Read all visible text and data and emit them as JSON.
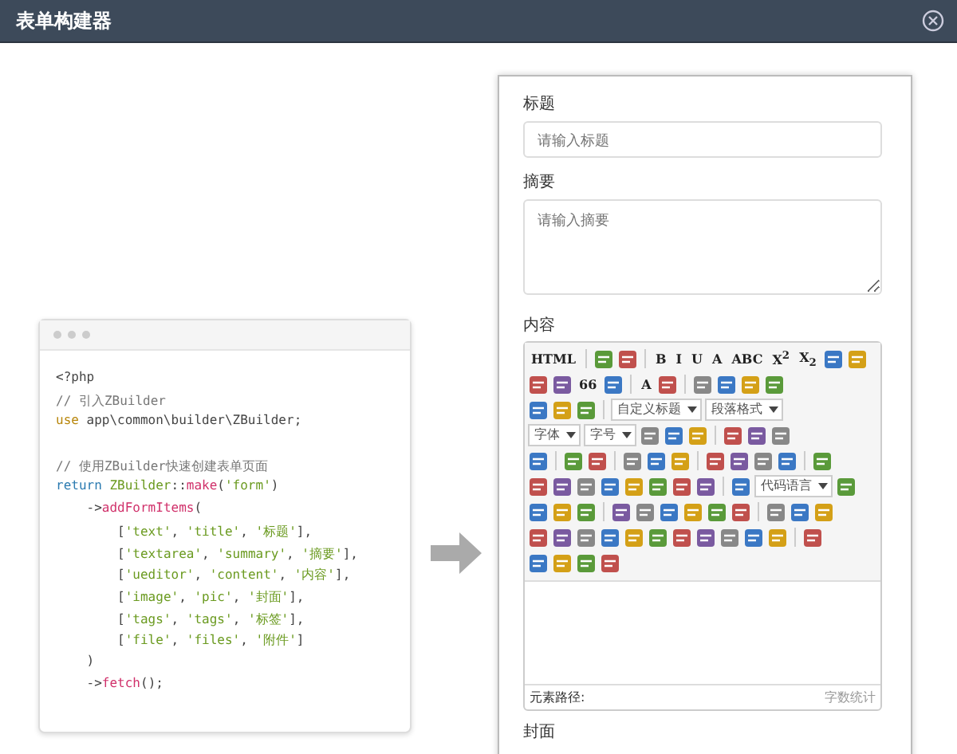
{
  "window": {
    "title": "表单构建器"
  },
  "code": {
    "lines": [
      [
        {
          "kind": "plain",
          "text": "<?php"
        }
      ],
      [
        {
          "kind": "comment",
          "text": "// 引入ZBuilder"
        }
      ],
      [
        {
          "kind": "keyword",
          "text": "use"
        },
        {
          "kind": "plain",
          "text": " app\\common\\builder\\ZBuilder;"
        }
      ],
      [
        {
          "kind": "comment",
          "text": "// 使用ZBuilder快速创建表单页面",
          "gap_before": true
        }
      ],
      [
        {
          "kind": "return",
          "text": "return "
        },
        {
          "kind": "string",
          "text": "ZBuilder"
        },
        {
          "kind": "plain",
          "text": "::"
        },
        {
          "kind": "func",
          "text": "make"
        },
        {
          "kind": "plain",
          "text": "("
        },
        {
          "kind": "string",
          "text": "'form'"
        },
        {
          "kind": "plain",
          "text": ")"
        }
      ],
      [
        {
          "kind": "plain",
          "text": "    ->"
        },
        {
          "kind": "func",
          "text": "addFormItems"
        },
        {
          "kind": "plain",
          "text": "("
        }
      ],
      [
        {
          "kind": "plain",
          "text": "        ["
        },
        {
          "kind": "string",
          "text": "'text'"
        },
        {
          "kind": "plain",
          "text": ", "
        },
        {
          "kind": "string",
          "text": "'title'"
        },
        {
          "kind": "plain",
          "text": ", "
        },
        {
          "kind": "string",
          "text": "'标题'"
        },
        {
          "kind": "plain",
          "text": "],"
        }
      ],
      [
        {
          "kind": "plain",
          "text": "        ["
        },
        {
          "kind": "string",
          "text": "'textarea'"
        },
        {
          "kind": "plain",
          "text": ", "
        },
        {
          "kind": "string",
          "text": "'summary'"
        },
        {
          "kind": "plain",
          "text": ", "
        },
        {
          "kind": "string",
          "text": "'摘要'"
        },
        {
          "kind": "plain",
          "text": "],"
        }
      ],
      [
        {
          "kind": "plain",
          "text": "        ["
        },
        {
          "kind": "string",
          "text": "'ueditor'"
        },
        {
          "kind": "plain",
          "text": ", "
        },
        {
          "kind": "string",
          "text": "'content'"
        },
        {
          "kind": "plain",
          "text": ", "
        },
        {
          "kind": "string",
          "text": "'内容'"
        },
        {
          "kind": "plain",
          "text": "],"
        }
      ],
      [
        {
          "kind": "plain",
          "text": "        ["
        },
        {
          "kind": "string",
          "text": "'image'"
        },
        {
          "kind": "plain",
          "text": ", "
        },
        {
          "kind": "string",
          "text": "'pic'"
        },
        {
          "kind": "plain",
          "text": ", "
        },
        {
          "kind": "string",
          "text": "'封面'"
        },
        {
          "kind": "plain",
          "text": "],"
        }
      ],
      [
        {
          "kind": "plain",
          "text": "        ["
        },
        {
          "kind": "string",
          "text": "'tags'"
        },
        {
          "kind": "plain",
          "text": ", "
        },
        {
          "kind": "string",
          "text": "'tags'"
        },
        {
          "kind": "plain",
          "text": ", "
        },
        {
          "kind": "string",
          "text": "'标签'"
        },
        {
          "kind": "plain",
          "text": "],"
        }
      ],
      [
        {
          "kind": "plain",
          "text": "        ["
        },
        {
          "kind": "string",
          "text": "'file'"
        },
        {
          "kind": "plain",
          "text": ", "
        },
        {
          "kind": "string",
          "text": "'files'"
        },
        {
          "kind": "plain",
          "text": ", "
        },
        {
          "kind": "string",
          "text": "'附件'"
        },
        {
          "kind": "plain",
          "text": "]"
        }
      ],
      [
        {
          "kind": "plain",
          "text": "    )"
        }
      ],
      [
        {
          "kind": "plain",
          "text": "    ->"
        },
        {
          "kind": "func",
          "text": "fetch"
        },
        {
          "kind": "plain",
          "text": "();"
        }
      ]
    ]
  },
  "form": {
    "title_field": {
      "label": "标题",
      "placeholder": "请输入标题"
    },
    "summary_field": {
      "label": "摘要",
      "placeholder": "请输入摘要"
    },
    "content_field": {
      "label": "内容",
      "toolbar": [
        [
          {
            "kind": "text",
            "text": "HTML"
          },
          {
            "kind": "sep"
          },
          {
            "kind": "icon"
          },
          {
            "kind": "icon"
          },
          {
            "kind": "sep"
          },
          {
            "kind": "text",
            "text": "B"
          },
          {
            "kind": "text",
            "text": "I"
          },
          {
            "kind": "text",
            "text": "U"
          },
          {
            "kind": "text",
            "text": "A"
          },
          {
            "kind": "text",
            "text": "ABC"
          },
          {
            "kind": "text",
            "text": "X$^{2}$"
          },
          {
            "kind": "text",
            "text": "X$_{2}$"
          },
          {
            "kind": "icon"
          },
          {
            "kind": "icon"
          }
        ],
        [
          {
            "kind": "icon"
          },
          {
            "kind": "icon"
          },
          {
            "kind": "text",
            "text": "66"
          },
          {
            "kind": "icon"
          },
          {
            "kind": "sep"
          },
          {
            "kind": "text",
            "text": "A"
          },
          {
            "kind": "icon"
          },
          {
            "kind": "sep"
          },
          {
            "kind": "icon"
          },
          {
            "kind": "icon"
          },
          {
            "kind": "icon"
          },
          {
            "kind": "icon"
          }
        ],
        [
          {
            "kind": "icon"
          },
          {
            "kind": "icon"
          },
          {
            "kind": "icon"
          },
          {
            "kind": "sep"
          },
          {
            "kind": "select",
            "text": "自定义标题"
          },
          {
            "kind": "select",
            "text": "段落格式"
          }
        ],
        [
          {
            "kind": "select",
            "text": "字体"
          },
          {
            "kind": "select",
            "text": "字号"
          },
          {
            "kind": "icon"
          },
          {
            "kind": "icon"
          },
          {
            "kind": "icon"
          },
          {
            "kind": "sep"
          },
          {
            "kind": "icon"
          },
          {
            "kind": "icon"
          },
          {
            "kind": "icon"
          }
        ],
        [
          {
            "kind": "icon"
          },
          {
            "kind": "sep"
          },
          {
            "kind": "icon"
          },
          {
            "kind": "icon"
          },
          {
            "kind": "sep"
          },
          {
            "kind": "icon"
          },
          {
            "kind": "icon"
          },
          {
            "kind": "icon"
          },
          {
            "kind": "sep"
          },
          {
            "kind": "icon"
          },
          {
            "kind": "icon"
          },
          {
            "kind": "icon"
          },
          {
            "kind": "icon"
          },
          {
            "kind": "sep"
          },
          {
            "kind": "icon"
          }
        ],
        [
          {
            "kind": "icon"
          },
          {
            "kind": "icon"
          },
          {
            "kind": "icon"
          },
          {
            "kind": "icon"
          },
          {
            "kind": "icon"
          },
          {
            "kind": "icon"
          },
          {
            "kind": "icon"
          },
          {
            "kind": "icon"
          },
          {
            "kind": "sep"
          },
          {
            "kind": "icon"
          },
          {
            "kind": "select",
            "text": "代码语言"
          },
          {
            "kind": "icon"
          }
        ],
        [
          {
            "kind": "icon"
          },
          {
            "kind": "icon"
          },
          {
            "kind": "icon"
          },
          {
            "kind": "sep"
          },
          {
            "kind": "icon"
          },
          {
            "kind": "icon"
          },
          {
            "kind": "icon"
          },
          {
            "kind": "icon"
          },
          {
            "kind": "icon"
          },
          {
            "kind": "icon"
          },
          {
            "kind": "sep"
          },
          {
            "kind": "icon"
          },
          {
            "kind": "icon"
          },
          {
            "kind": "icon"
          }
        ],
        [
          {
            "kind": "icon"
          },
          {
            "kind": "icon"
          },
          {
            "kind": "icon"
          },
          {
            "kind": "icon"
          },
          {
            "kind": "icon"
          },
          {
            "kind": "icon"
          },
          {
            "kind": "icon"
          },
          {
            "kind": "icon"
          },
          {
            "kind": "icon"
          },
          {
            "kind": "icon"
          },
          {
            "kind": "icon"
          },
          {
            "kind": "sep"
          },
          {
            "kind": "icon"
          }
        ],
        [
          {
            "kind": "icon"
          },
          {
            "kind": "icon"
          },
          {
            "kind": "icon"
          },
          {
            "kind": "icon"
          }
        ]
      ],
      "path_label": "元素路径:",
      "word_count": "字数统计"
    },
    "cover_field": {
      "label": "封面"
    }
  }
}
